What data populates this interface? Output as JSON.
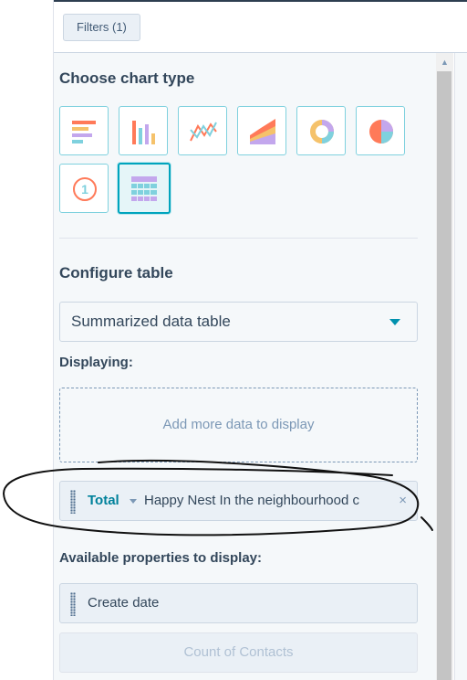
{
  "toolbar": {
    "filters_label": "Filters (1)"
  },
  "chart_type": {
    "heading": "Choose chart type",
    "options": [
      {
        "icon": "horizontal-bar-chart-icon"
      },
      {
        "icon": "vertical-bar-chart-icon"
      },
      {
        "icon": "line-chart-icon"
      },
      {
        "icon": "area-chart-icon"
      },
      {
        "icon": "donut-chart-icon"
      },
      {
        "icon": "pie-chart-icon"
      },
      {
        "icon": "kpi-number-icon",
        "glyph": "1"
      },
      {
        "icon": "table-chart-icon",
        "selected": true
      }
    ]
  },
  "configure": {
    "heading": "Configure table",
    "table_type": "Summarized data table",
    "displaying_label": "Displaying:",
    "dropzone_text": "Add more data to display",
    "displayed_item": {
      "aggregation": "Total",
      "property": "Happy Nest In the neighbourhood c",
      "remove_glyph": "×"
    },
    "available_label": "Available properties to display:",
    "available_items": [
      {
        "label": "Create date"
      }
    ],
    "disabled_item": "Count of Contacts"
  },
  "colors": {
    "accent": "#00a4bd",
    "link": "#00819b",
    "text": "#33475b",
    "panel_bg": "#f5f8fa"
  }
}
